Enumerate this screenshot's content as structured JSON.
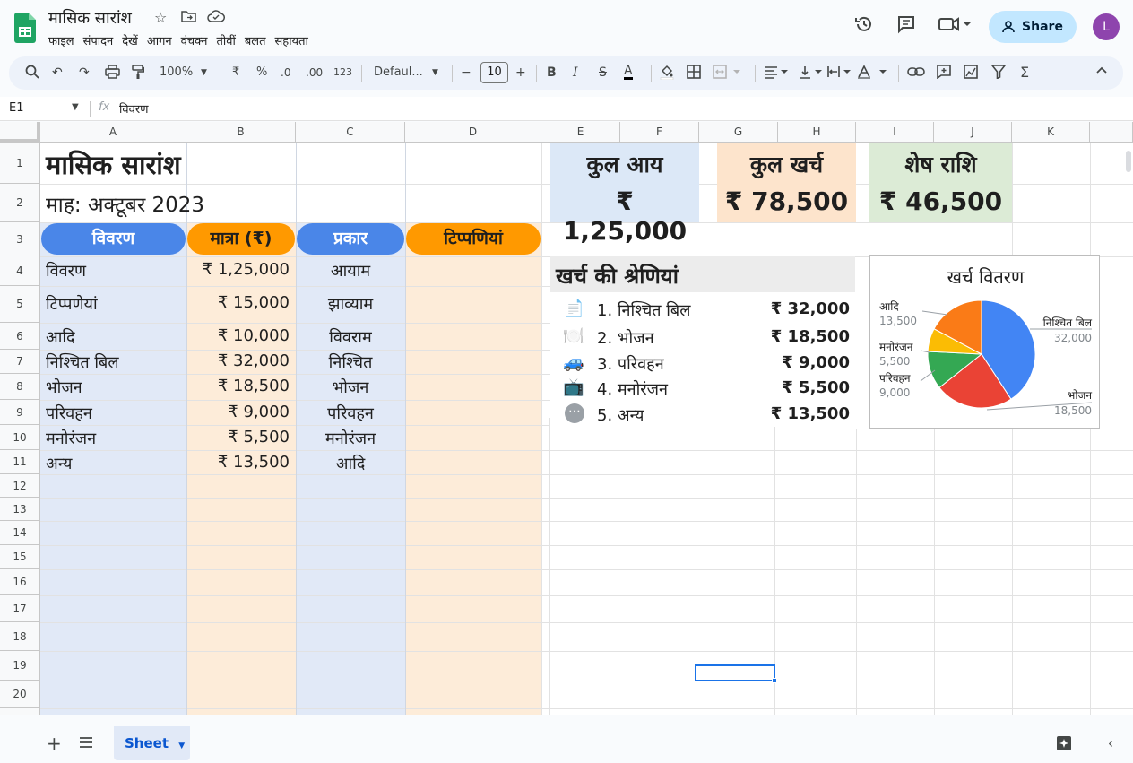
{
  "app": {
    "doc_title": "मासिक सारांश",
    "menu": [
      "फाइल",
      "संपादन",
      "देखें",
      "आगन",
      "वंचक्न",
      "तीवीं",
      "बलत",
      "सहायता"
    ],
    "share_label": "Share",
    "avatar_letter": "L"
  },
  "toolbar": {
    "zoom": "100%",
    "currency": "₹",
    "percent": "%",
    "dec_less": ".0",
    "dec_more": ".00",
    "number_format": "123",
    "font": "Defaul...",
    "font_size": "10",
    "bold": "B",
    "italic": "I",
    "strike": "S",
    "text_color": "A"
  },
  "formula_bar": {
    "cell_ref": "E1",
    "fx": "fx",
    "content": "विवरण"
  },
  "columns": [
    "A",
    "B",
    "C",
    "D",
    "E",
    "F",
    "G",
    "H",
    "I",
    "J",
    "K"
  ],
  "rows": [
    "1",
    "2",
    "3",
    "4",
    "5",
    "6",
    "7",
    "8",
    "9",
    "10",
    "11",
    "12",
    "13",
    "14",
    "15",
    "16",
    "17",
    "18",
    "19",
    "20"
  ],
  "sheet": {
    "title": "मासिक सारांश",
    "month": "माह: अक्टूबर 2023",
    "headers": [
      "विवरण",
      "मात्रा (₹)",
      "प्रकार",
      "टिप्पणियां"
    ],
    "table": [
      {
        "desc": "विवरण",
        "amount": "₹ 1,25,000",
        "type": "आयाम"
      },
      {
        "desc": "टिप्पणेयां",
        "amount": "₹ 15,000",
        "type": "झाव्याम"
      },
      {
        "desc": "आदि",
        "amount": "₹ 10,000",
        "type": "विवराम"
      },
      {
        "desc": "निश्चित बिल",
        "amount": "₹ 32,000",
        "type": "निश्चित"
      },
      {
        "desc": "भोजन",
        "amount": "₹ 18,500",
        "type": "भोजन"
      },
      {
        "desc": "परिवहन",
        "amount": "₹ 9,000",
        "type": "परिवहन"
      },
      {
        "desc": "मनोरंजन",
        "amount": "₹ 5,500",
        "type": "मनोरंजन"
      },
      {
        "desc": "अन्य",
        "amount": "₹ 13,500",
        "type": "आदि"
      }
    ],
    "kpis": [
      {
        "label": "कुल आय",
        "value": "₹ 1,25,000",
        "color": "#dce8f7"
      },
      {
        "label": "कुल खर्च",
        "value": "₹ 78,500",
        "color": "#fde4cc"
      },
      {
        "label": "शेष राशि",
        "value": "₹ 46,500",
        "color": "#dcebd6"
      }
    ],
    "categories_title": "खर्च की श्रेणियां",
    "categories": [
      {
        "icon": "📄",
        "label": "1. निश्चित बिल",
        "amount": "₹ 32,000"
      },
      {
        "icon": "🍽️",
        "label": "2. भोजन",
        "amount": "₹ 18,500"
      },
      {
        "icon": "🚙",
        "label": "3. परिवहन",
        "amount": "₹ 9,000"
      },
      {
        "icon": "📺",
        "label": "4. मनोरंजन",
        "amount": "₹ 5,500"
      },
      {
        "icon": "⋯",
        "label": "5. अन्य",
        "amount": "₹ 13,500"
      }
    ]
  },
  "chart_data": {
    "type": "pie",
    "title": "खर्च वितरण",
    "slices": [
      {
        "name": "निश्चित बिल",
        "value": 32000,
        "value_label": "32,000",
        "color": "#4285f4"
      },
      {
        "name": "भोजन",
        "value": 18500,
        "value_label": "18,500",
        "color": "#ea4335"
      },
      {
        "name": "परिवहन",
        "value": 9000,
        "value_label": "9,000",
        "color": "#34a853"
      },
      {
        "name": "मनोरंजन",
        "value": 5500,
        "value_label": "5,500",
        "color": "#fbbc04"
      },
      {
        "name": "आदि",
        "value": 13500,
        "value_label": "13,500",
        "color": "#fa7b17"
      }
    ]
  },
  "tabs": {
    "sheet_name": "Sheet"
  },
  "colors": {
    "band_blue": "#e1e9f7",
    "band_orange": "#fdecd9",
    "pill_blue": "#4a86e8",
    "pill_orange": "#ff9900",
    "accent": "#0b57d0"
  }
}
